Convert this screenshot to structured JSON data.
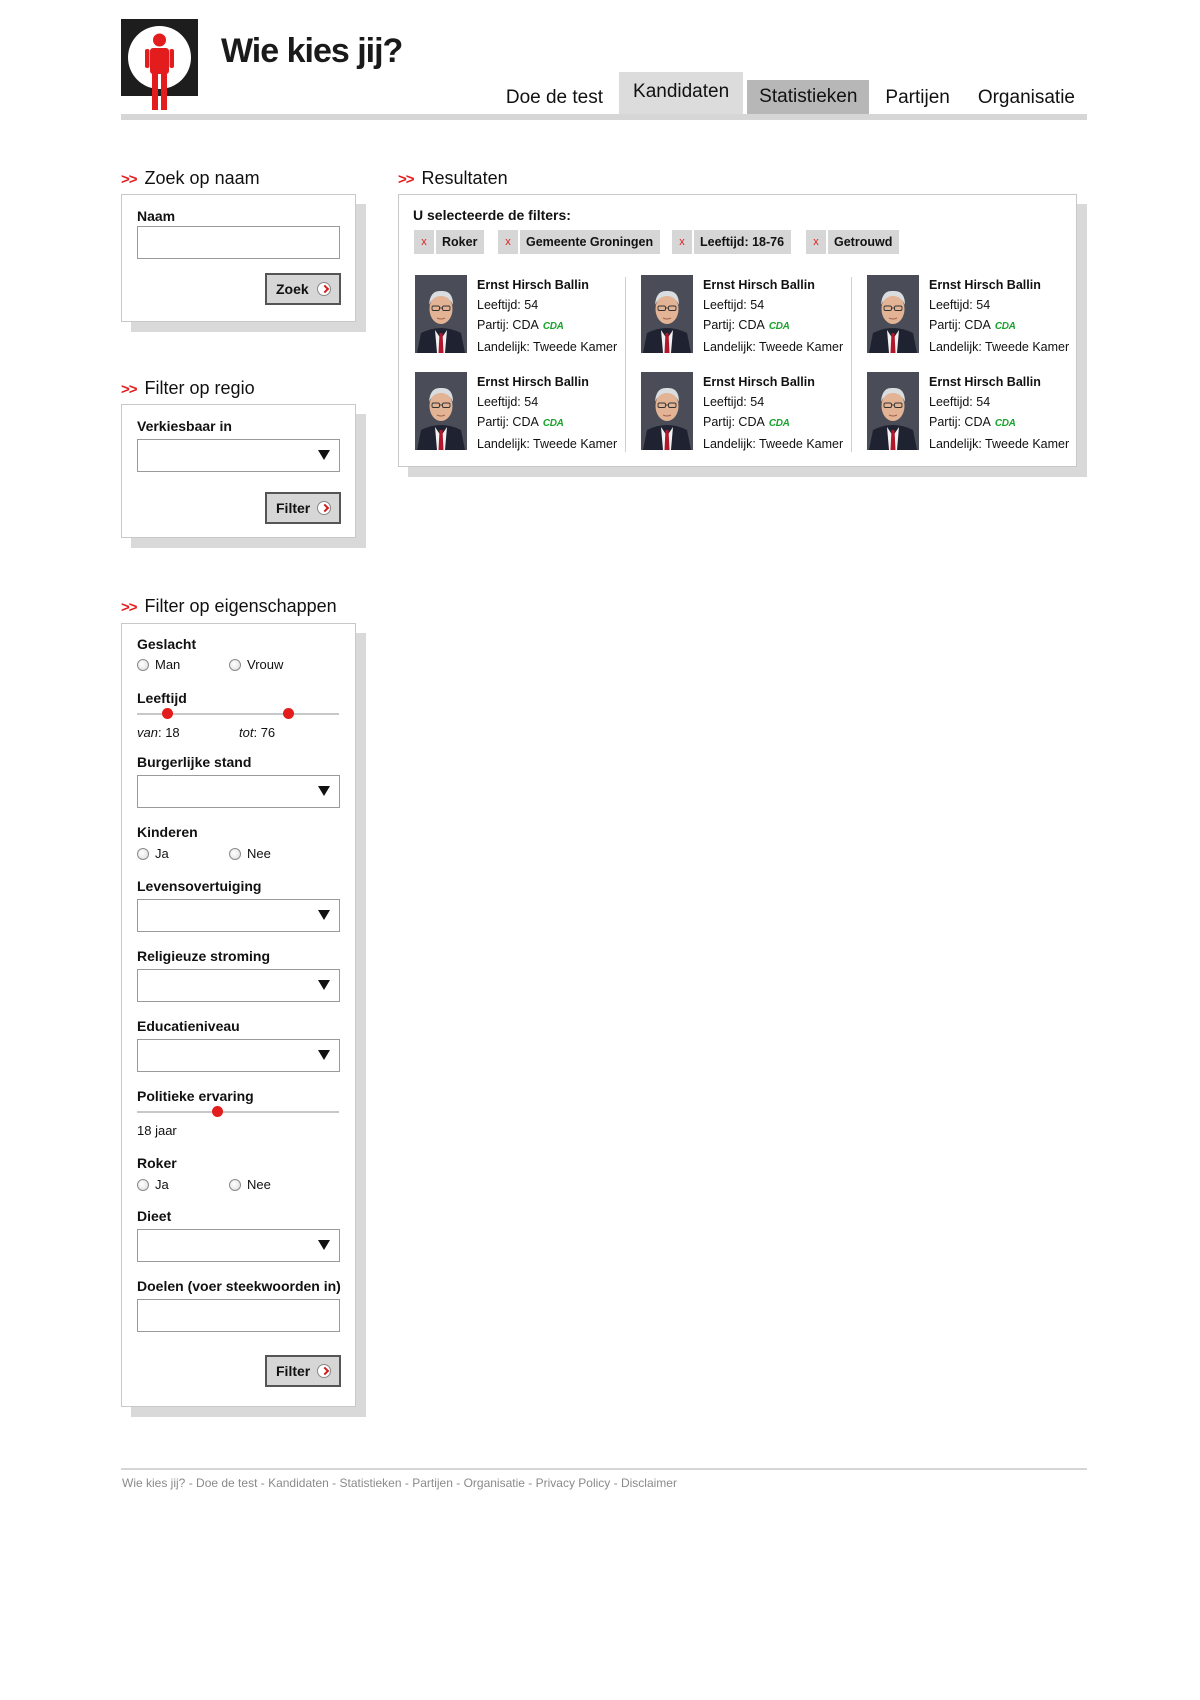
{
  "header": {
    "site_title": "Wie kies jij?",
    "nav": [
      "Doe de test",
      "Kandidaten",
      "Statistieken",
      "Partijen",
      "Organisatie"
    ],
    "active_tab": "Kandidaten",
    "accent_color": "#e31d1d"
  },
  "search": {
    "heading": "Zoek op naam",
    "name_label": "Naam",
    "name_value": "",
    "button": "Zoek"
  },
  "region": {
    "heading": "Filter op regio",
    "label": "Verkiesbaar in",
    "selected": "",
    "button": "Filter"
  },
  "properties": {
    "heading": "Filter op eigenschappen",
    "gender": {
      "label": "Geslacht",
      "options": [
        "Man",
        "Vrouw"
      ]
    },
    "age": {
      "label": "Leeftijd",
      "van_label": "van",
      "tot_label": "tot",
      "van": "18",
      "tot": "76",
      "min_fraction": 0.15,
      "max_fraction": 0.75
    },
    "marital": {
      "label": "Burgerlijke stand",
      "selected": ""
    },
    "children": {
      "label": "Kinderen",
      "options": [
        "Ja",
        "Nee"
      ]
    },
    "belief": {
      "label": "Levensovertuiging",
      "selected": ""
    },
    "religion": {
      "label": "Religieuze stroming",
      "selected": ""
    },
    "education": {
      "label": "Educatieniveau",
      "selected": ""
    },
    "experience": {
      "label": "Politieke ervaring",
      "value": "18 jaar",
      "fraction": 0.4
    },
    "smoker": {
      "label": "Roker",
      "options": [
        "Ja",
        "Nee"
      ]
    },
    "diet": {
      "label": "Dieet",
      "selected": ""
    },
    "goals": {
      "label": "Doelen (voer steekwoorden in)",
      "value": ""
    },
    "button": "Filter"
  },
  "results": {
    "heading": "Resultaten",
    "filters_label": "U selecteerde de filters:",
    "remove_symbol": "x",
    "filters": [
      "Roker",
      "Gemeente Groningen",
      "Leeftijd: 18-76",
      "Getrouwd"
    ],
    "candidates": [
      {
        "name": "Ernst Hirsch Ballin",
        "age": "Leeftijd: 54",
        "party": "Partij: CDA",
        "party_logo": "CDA",
        "level": "Landelijk: Tweede Kamer"
      },
      {
        "name": "Ernst Hirsch Ballin",
        "age": "Leeftijd: 54",
        "party": "Partij: CDA",
        "party_logo": "CDA",
        "level": "Landelijk: Tweede Kamer"
      },
      {
        "name": "Ernst Hirsch Ballin",
        "age": "Leeftijd: 54",
        "party": "Partij: CDA",
        "party_logo": "CDA",
        "level": "Landelijk: Tweede Kamer"
      },
      {
        "name": "Ernst Hirsch Ballin",
        "age": "Leeftijd: 54",
        "party": "Partij: CDA",
        "party_logo": "CDA",
        "level": "Landelijk: Tweede Kamer"
      },
      {
        "name": "Ernst Hirsch Ballin",
        "age": "Leeftijd: 54",
        "party": "Partij: CDA",
        "party_logo": "CDA",
        "level": "Landelijk: Tweede Kamer"
      },
      {
        "name": "Ernst Hirsch Ballin",
        "age": "Leeftijd: 54",
        "party": "Partij: CDA",
        "party_logo": "CDA",
        "level": "Landelijk: Tweede Kamer"
      }
    ]
  },
  "footer": {
    "links": [
      "Wie kies jij?",
      "Doe de test",
      "Kandidaten",
      "Statistieken",
      "Partijen",
      "Organisatie",
      "Privacy Policy",
      "Disclaimer"
    ],
    "separator": " - "
  }
}
